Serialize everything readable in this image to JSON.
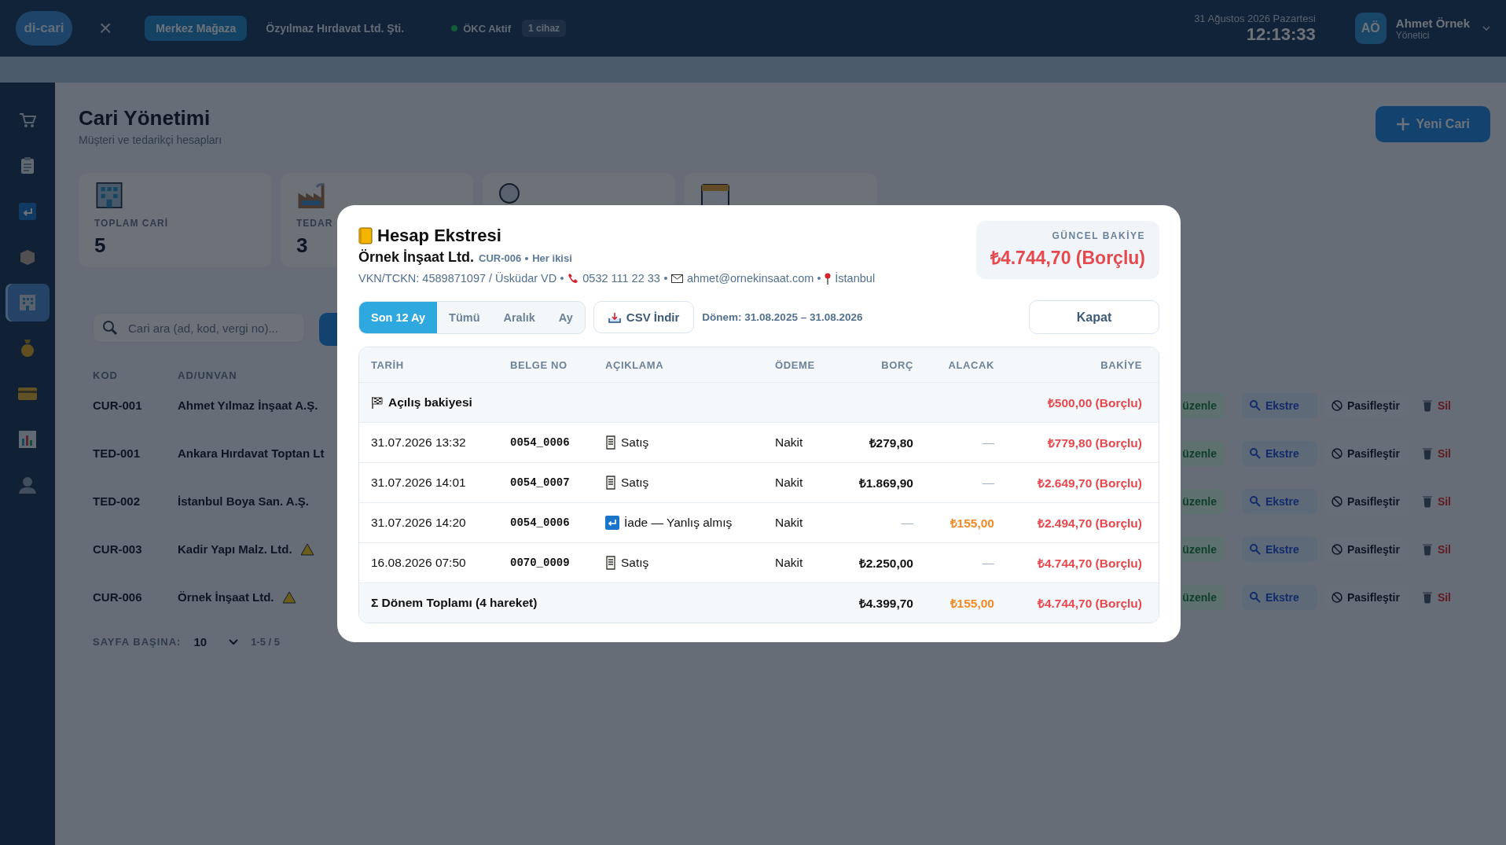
{
  "top_bar": {
    "logo": "di-cari",
    "close": "×",
    "store": "Merkez Mağaza",
    "company": "Özyılmaz Hırdavat Ltd. Şti.",
    "okc_status": "ÖKC Aktif",
    "device_count": "1 cihaz",
    "date": "31 Ağustos 2026 Pazartesi",
    "time": "12:13:33",
    "user": {
      "initials": "AÖ",
      "name": "Ahmet Örnek",
      "role": "Yönetici"
    }
  },
  "sidebar": {
    "items": [
      {
        "kind": "cart",
        "selected": false
      },
      {
        "kind": "clipboard",
        "selected": false
      },
      {
        "kind": "return",
        "selected": false
      },
      {
        "kind": "box",
        "selected": false
      },
      {
        "kind": "building",
        "selected": true
      },
      {
        "kind": "moneybag",
        "selected": false
      },
      {
        "kind": "card",
        "selected": false
      },
      {
        "kind": "chart",
        "selected": false
      },
      {
        "kind": "person",
        "selected": false
      }
    ]
  },
  "page": {
    "title": "Cari Yönetimi",
    "subtitle": "Müşteri ve tedarikçi hesapları",
    "new_button": "Yeni Cari",
    "stats": [
      {
        "kind": "building",
        "label": "TOPLAM CARİ",
        "value": "5"
      },
      {
        "kind": "factory",
        "label": "TEDAR",
        "value": "3"
      },
      {
        "kind": "person"
      },
      {
        "kind": "calendar"
      }
    ],
    "search": {
      "placeholder": "Cari ara (ad, kod, vergi no)..."
    },
    "table": {
      "columns": [
        "KOD",
        "AD/UNVAN"
      ],
      "rows": [
        {
          "code": "CUR-001",
          "name": "Ahmet Yılmaz İnşaat A.Ş.",
          "warning": false,
          "actions": [
            "üzenle",
            "Ekstre",
            "Pasifleştir",
            "Sil"
          ]
        },
        {
          "code": "TED-001",
          "name": "Ankara Hırdavat Toptan Lt",
          "warning": false,
          "actions": [
            "üzenle",
            "Ekstre",
            "Pasifleştir",
            "Sil"
          ]
        },
        {
          "code": "TED-002",
          "name": "İstanbul Boya San. A.Ş.",
          "warning": false,
          "actions": [
            "üzenle",
            "Ekstre",
            "Pasifleştir",
            "Sil"
          ]
        },
        {
          "code": "CUR-003",
          "name": "Kadir Yapı Malz. Ltd.",
          "warning": true,
          "actions": [
            "üzenle",
            "Ekstre",
            "Pasifleştir",
            "Sil"
          ]
        },
        {
          "code": "CUR-006",
          "name": "Örnek İnşaat Ltd.",
          "warning": true,
          "actions": [
            "üzenle",
            "Ekstre",
            "Pasifleştir",
            "Sil"
          ]
        }
      ]
    },
    "pagination": {
      "label": "SAYFA BAŞINA:",
      "page_size": "10",
      "range": "1-5 / 5"
    }
  },
  "modal": {
    "title": "Hesap Ekstresi",
    "customer": "Örnek İnşaat Ltd.",
    "code": "CUR-006",
    "type": "Her ikisi",
    "tax": "VKN/TCKN: 4589871097 / Üsküdar VD",
    "phone": "0532 111 22 33",
    "email": "ahmet@ornekinsaat.com",
    "city": "İstanbul",
    "balance_label": "GÜNCEL BAKİYE",
    "balance": "₺4.744,70 (Borçlu)",
    "tabs": [
      {
        "label": "Son 12 Ay",
        "selected": true
      },
      {
        "label": "Tümü",
        "selected": false
      },
      {
        "label": "Aralık",
        "selected": false
      },
      {
        "label": "Ay",
        "selected": false
      }
    ],
    "csv_button": "CSV İndir",
    "period": "Dönem: 31.08.2025 – 31.08.2026",
    "close_button": "Kapat",
    "table": {
      "columns": [
        "TARİH",
        "BELGE NO",
        "AÇIKLAMA",
        "ÖDEME",
        "BORÇ",
        "ALACAK",
        "BAKİYE"
      ],
      "opening": {
        "label": "Açılış bakiyesi",
        "balance": "₺500,00 (Borçlu)"
      },
      "rows": [
        {
          "date": "31.07.2026 13:32",
          "doc": "0054_0006",
          "kind": "sale",
          "description": "Satış",
          "payment": "Nakit",
          "debit": "₺279,80",
          "credit": "—",
          "balance": "₺779,80 (Borçlu)"
        },
        {
          "date": "31.07.2026 14:01",
          "doc": "0054_0007",
          "kind": "sale",
          "description": "Satış",
          "payment": "Nakit",
          "debit": "₺1.869,90",
          "credit": "—",
          "balance": "₺2.649,70 (Borçlu)"
        },
        {
          "date": "31.07.2026 14:20",
          "doc": "0054_0006",
          "kind": "return",
          "description": "İade — Yanlış almış",
          "payment": "Nakit",
          "debit": "—",
          "credit": "₺155,00",
          "balance": "₺2.494,70 (Borçlu)"
        },
        {
          "date": "16.08.2026 07:50",
          "doc": "0070_0009",
          "kind": "sale",
          "description": "Satış",
          "payment": "Nakit",
          "debit": "₺2.250,00",
          "credit": "—",
          "balance": "₺4.744,70 (Borçlu)"
        }
      ],
      "total": {
        "label": "Σ Dönem Toplamı (4 hareket)",
        "debit": "₺4.399,70",
        "credit": "₺155,00",
        "balance": "₺4.744,70 (Borçlu)"
      }
    }
  }
}
